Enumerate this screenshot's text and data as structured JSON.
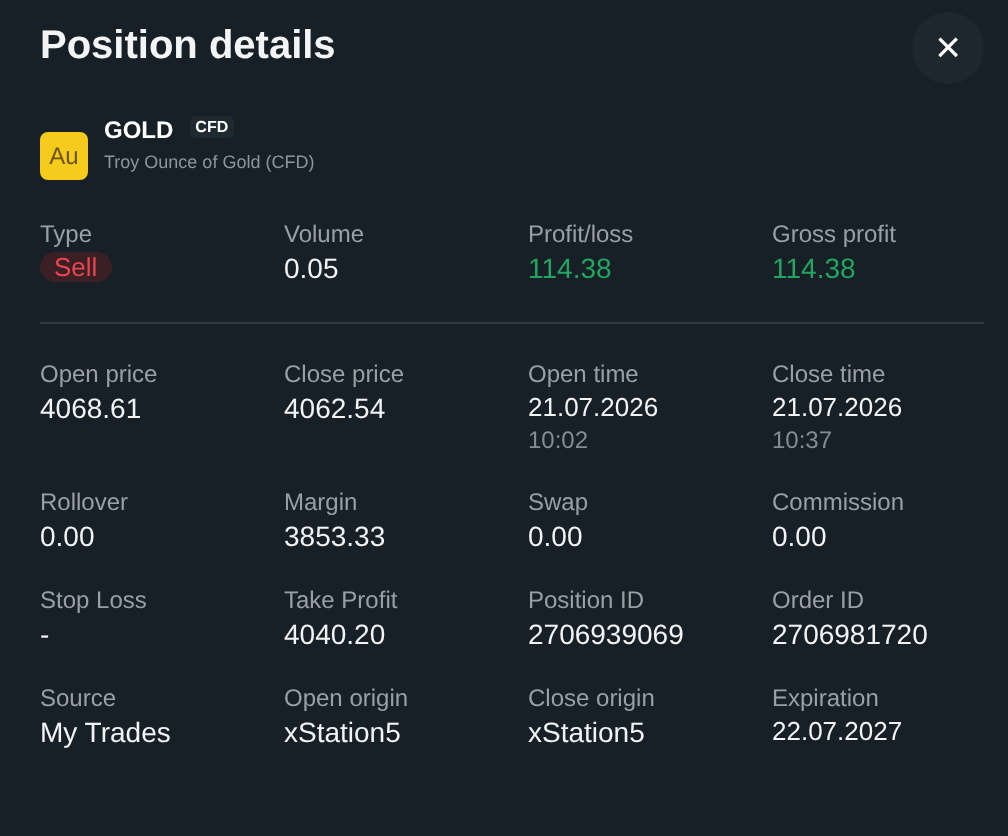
{
  "title": "Position details",
  "close": "×",
  "instrument": {
    "icon": "Au",
    "symbol": "GOLD",
    "badge": "CFD",
    "description": "Troy Ounce of Gold (CFD)"
  },
  "summary": [
    {
      "label": "Type",
      "value": "Sell",
      "kind": "sell"
    },
    {
      "label": "Volume",
      "value": "0.05",
      "kind": "plain"
    },
    {
      "label": "Profit/loss",
      "value": "114.38",
      "kind": "profit"
    },
    {
      "label": "Gross profit",
      "value": "114.38",
      "kind": "profit"
    }
  ],
  "details": [
    {
      "label": "Open price",
      "value": "4068.61",
      "kind": "plain"
    },
    {
      "label": "Close price",
      "value": "4062.54",
      "kind": "plain"
    },
    {
      "label": "Open time",
      "value": "21.07.2026",
      "sub": "10:02",
      "kind": "date"
    },
    {
      "label": "Close time",
      "value": "21.07.2026",
      "sub": "10:37",
      "kind": "date"
    },
    {
      "label": "Rollover",
      "value": "0.00",
      "kind": "plain"
    },
    {
      "label": "Margin",
      "value": "3853.33",
      "kind": "plain"
    },
    {
      "label": "Swap",
      "value": "0.00",
      "kind": "plain"
    },
    {
      "label": "Commission",
      "value": "0.00",
      "kind": "plain"
    },
    {
      "label": "Stop Loss",
      "value": "-",
      "kind": "plain"
    },
    {
      "label": "Take Profit",
      "value": "4040.20",
      "kind": "plain"
    },
    {
      "label": "Position ID",
      "value": "2706939069",
      "kind": "plain"
    },
    {
      "label": "Order ID",
      "value": "2706981720",
      "kind": "plain"
    },
    {
      "label": "Source",
      "value": "My Trades",
      "kind": "plain"
    },
    {
      "label": "Open origin",
      "value": "xStation5",
      "kind": "plain"
    },
    {
      "label": "Close origin",
      "value": "xStation5",
      "kind": "plain"
    },
    {
      "label": "Expiration",
      "value": "22.07.2027",
      "kind": "date"
    }
  ]
}
